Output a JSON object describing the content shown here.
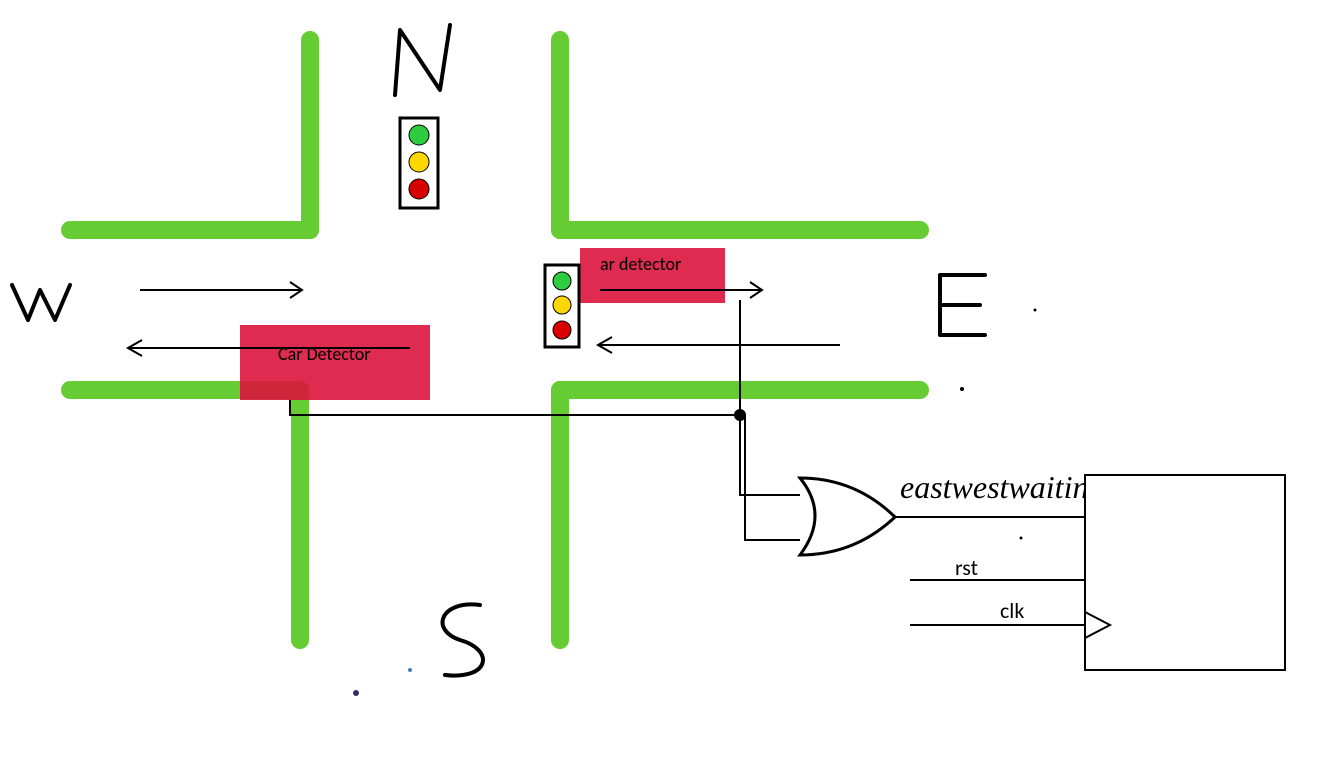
{
  "directions": {
    "north": "N",
    "south": "S",
    "east": "E",
    "west": "W"
  },
  "detectors": {
    "west": "Car Detector",
    "east": "ar detector"
  },
  "signals": {
    "output": "eastwestwaiting",
    "reset": "rst",
    "clock": "clk"
  },
  "traffic_light": {
    "colors": [
      "green",
      "yellow",
      "red"
    ]
  },
  "colors": {
    "road": "#66CC33",
    "detector": "#DC143C",
    "stroke": "#000000"
  }
}
